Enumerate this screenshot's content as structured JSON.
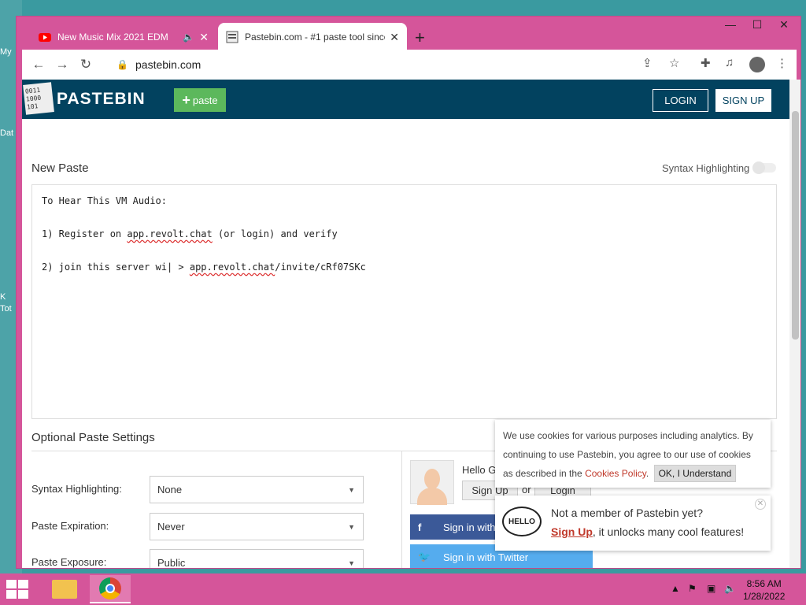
{
  "desktop": {
    "labels": [
      "My",
      "Dat",
      "K",
      "Tot"
    ]
  },
  "browser": {
    "tabs": [
      {
        "title": "New Music Mix 2021 EDM",
        "active": false,
        "icon": "youtube-icon",
        "audio_icon": "speaker-icon"
      },
      {
        "title": "Pastebin.com - #1 paste tool since",
        "active": true,
        "icon": "pastebin-icon"
      }
    ],
    "new_tab": "+",
    "url": "pastebin.com",
    "window_controls": [
      "—",
      "☐",
      "✕"
    ]
  },
  "pastebin": {
    "logo_bits": "0011\n1000\n101",
    "logo_text": "PASTEBIN",
    "paste_button": "paste",
    "login": "LOGIN",
    "signup": "SIGN UP",
    "new_paste_title": "New Paste",
    "syntax_toggle_label": "Syntax Highlighting",
    "editor": {
      "line1": "To Hear This VM Audio:",
      "line2_pre": "1) Register on ",
      "line2_link": "app.revolt.chat",
      "line2_post": " (or login) and verify",
      "line3_pre": "2) join this server wi| > ",
      "line3_link": "app.revolt.chat",
      "line3_post": "/invite/cRf07SKc"
    },
    "optional_settings_title": "Optional Paste Settings",
    "settings": [
      {
        "label": "Syntax Highlighting:",
        "value": "None"
      },
      {
        "label": "Paste Expiration:",
        "value": "Never"
      },
      {
        "label": "Paste Exposure:",
        "value": "Public"
      }
    ],
    "side": {
      "hello": "Hello G",
      "signup": "Sign Up",
      "or": "or",
      "login": "Login",
      "facebook": "Sign in with F",
      "twitter": "Sign in with Twitter"
    },
    "cookie": {
      "text": "We use cookies for various purposes including analytics. By continuing to use Pastebin, you agree to our use of cookies as described in the",
      "policy": "Cookies Policy",
      "ok": "OK, I Understand"
    },
    "member": {
      "bubble": "HELLO",
      "question": "Not a member of Pastebin yet?",
      "signup": "Sign Up",
      "rest": ", it unlocks many cool features!"
    }
  },
  "taskbar": {
    "time": "8:56 AM",
    "date": "1/28/2022",
    "tray": [
      "▲",
      "⚑",
      "▣",
      "🔈"
    ]
  }
}
